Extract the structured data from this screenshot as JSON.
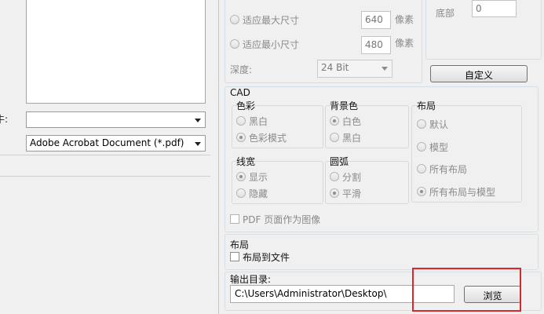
{
  "left": {
    "field_label_fragment": "牛:",
    "combo_empty_value": "",
    "file_type_value": "Adobe Acrobat Document (*.pdf)"
  },
  "raster": {
    "fit_max_label": "适应最大尺寸",
    "fit_max_value": "640",
    "fit_min_label": "适应最小尺寸",
    "fit_min_value": "480",
    "unit_pixels": "像素",
    "depth_label": "深度:",
    "depth_value": "24 Bit",
    "bottom_label": "底部",
    "bottom_value": "0",
    "custom_button": "自定义"
  },
  "cad": {
    "title": "CAD",
    "color": {
      "title": "色彩",
      "options": [
        "黑白",
        "色彩模式"
      ],
      "selected": "色彩模式"
    },
    "background": {
      "title": "背景色",
      "options": [
        "白色",
        "黑白"
      ],
      "selected": "白色"
    },
    "layout": {
      "title": "布局",
      "options": [
        "默认",
        "模型",
        "所有布局",
        "所有布局与模型"
      ],
      "selected": "所有布局与模型"
    },
    "lineweight": {
      "title": "线宽",
      "options": [
        "显示",
        "隐藏"
      ],
      "selected": "显示"
    },
    "arc": {
      "title": "圆弧",
      "options": [
        "分割",
        "平滑"
      ],
      "selected": "平滑"
    },
    "pdf_as_image_label": "PDF 页面作为图像"
  },
  "layout_section": {
    "title": "布局",
    "layout_to_file_label": "布局到文件"
  },
  "output": {
    "title": "输出目录:",
    "path_value": "C:\\Users\\Administrator\\Desktop\\",
    "browse_button": "浏览",
    "highlight_color": "#d9272e"
  }
}
